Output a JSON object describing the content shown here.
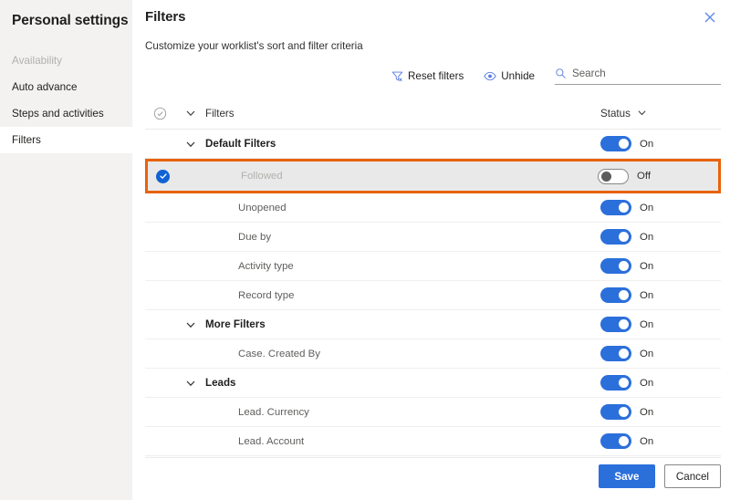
{
  "sidebar": {
    "title": "Personal settings",
    "items": [
      {
        "label": "Availability",
        "state": "disabled"
      },
      {
        "label": "Auto advance",
        "state": "normal"
      },
      {
        "label": "Steps and activities",
        "state": "normal"
      },
      {
        "label": "Filters",
        "state": "selected"
      }
    ]
  },
  "panel": {
    "title": "Filters",
    "subtitle": "Customize your worklist's sort and filter criteria",
    "close_icon": "close-icon"
  },
  "commandbar": {
    "reset_filters": {
      "label": "Reset filters",
      "icon": "reset-filter-icon"
    },
    "unhide": {
      "label": "Unhide",
      "icon": "eye-icon"
    },
    "search": {
      "placeholder": "Search",
      "value": "",
      "icon": "search-icon"
    }
  },
  "table": {
    "header": {
      "select_icon": "circle-check-icon",
      "expand_icon": "chevron-down-icon",
      "name_label": "Filters",
      "status_label": "Status",
      "status_sort_icon": "chevron-down-icon"
    },
    "rows": [
      {
        "label": "Default Filters",
        "type": "group",
        "status": "On",
        "toggle": "on",
        "checked": false,
        "highlighted": false
      },
      {
        "label": "Followed",
        "type": "child",
        "status": "Off",
        "toggle": "off",
        "checked": true,
        "highlighted": true
      },
      {
        "label": "Unopened",
        "type": "child",
        "status": "On",
        "toggle": "on",
        "checked": false,
        "highlighted": false
      },
      {
        "label": "Due by",
        "type": "child",
        "status": "On",
        "toggle": "on",
        "checked": false,
        "highlighted": false
      },
      {
        "label": "Activity type",
        "type": "child",
        "status": "On",
        "toggle": "on",
        "checked": false,
        "highlighted": false
      },
      {
        "label": "Record type",
        "type": "child",
        "status": "On",
        "toggle": "on",
        "checked": false,
        "highlighted": false
      },
      {
        "label": "More Filters",
        "type": "group",
        "status": "On",
        "toggle": "on",
        "checked": false,
        "highlighted": false
      },
      {
        "label": "Case. Created By",
        "type": "child",
        "status": "On",
        "toggle": "on",
        "checked": false,
        "highlighted": false
      },
      {
        "label": "Leads",
        "type": "group",
        "status": "On",
        "toggle": "on",
        "checked": false,
        "highlighted": false
      },
      {
        "label": "Lead. Currency",
        "type": "child",
        "status": "On",
        "toggle": "on",
        "checked": false,
        "highlighted": false
      },
      {
        "label": "Lead. Account",
        "type": "child",
        "status": "On",
        "toggle": "on",
        "checked": false,
        "highlighted": false
      }
    ]
  },
  "footer": {
    "save_label": "Save",
    "cancel_label": "Cancel"
  },
  "colors": {
    "accent": "#2b6fdb",
    "highlight": "#e8620c",
    "sidebar_bg": "#f3f2f1",
    "icon_blue": "#5b7ce0"
  }
}
